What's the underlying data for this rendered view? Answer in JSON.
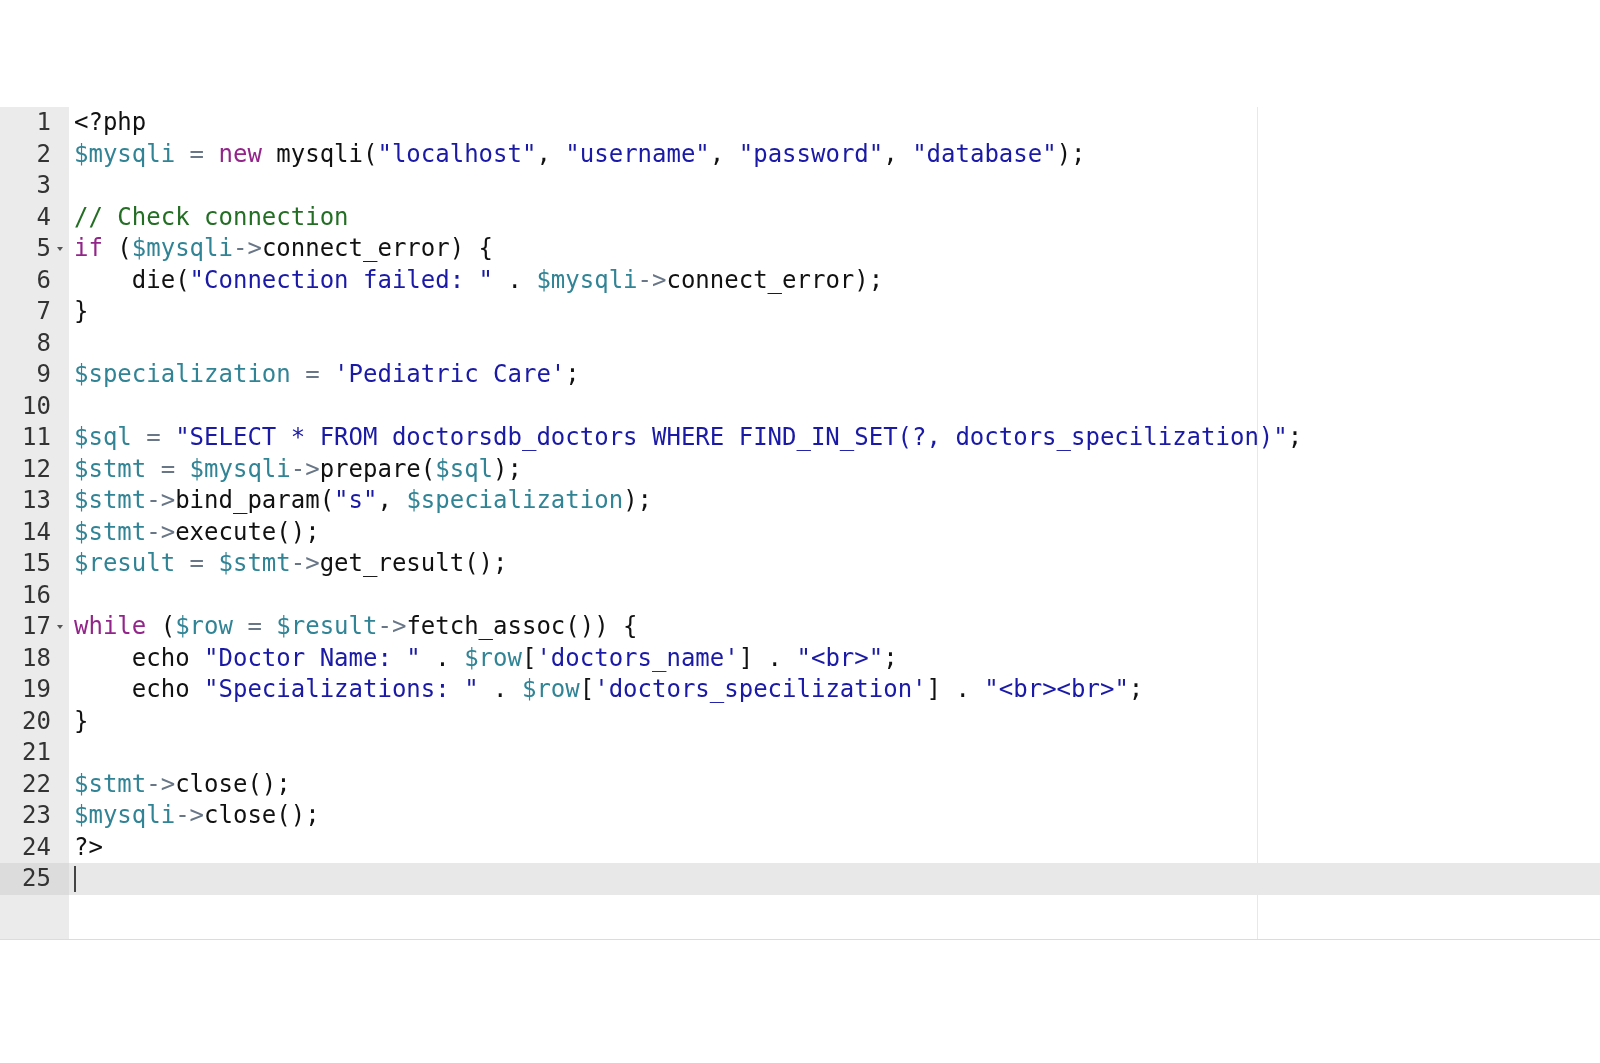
{
  "editor": {
    "lines": [
      {
        "number": "1",
        "foldable": false,
        "active": false,
        "tokens": [
          {
            "kind": "plain",
            "text": "<?php"
          }
        ]
      },
      {
        "number": "2",
        "foldable": false,
        "active": false,
        "tokens": [
          {
            "kind": "variable",
            "text": "$mysqli"
          },
          {
            "kind": "operator",
            "text": " = "
          },
          {
            "kind": "keyword",
            "text": "new"
          },
          {
            "kind": "plain",
            "text": " mysqli("
          },
          {
            "kind": "string",
            "text": "\"localhost\""
          },
          {
            "kind": "plain",
            "text": ", "
          },
          {
            "kind": "string",
            "text": "\"username\""
          },
          {
            "kind": "plain",
            "text": ", "
          },
          {
            "kind": "string",
            "text": "\"password\""
          },
          {
            "kind": "plain",
            "text": ", "
          },
          {
            "kind": "string",
            "text": "\"database\""
          },
          {
            "kind": "plain",
            "text": ");"
          }
        ]
      },
      {
        "number": "3",
        "foldable": false,
        "active": false
      },
      {
        "number": "4",
        "foldable": false,
        "active": false,
        "tokens": [
          {
            "kind": "comment",
            "text": "// Check connection"
          }
        ]
      },
      {
        "number": "5",
        "foldable": true,
        "active": false,
        "tokens": [
          {
            "kind": "keyword",
            "text": "if"
          },
          {
            "kind": "plain",
            "text": " ("
          },
          {
            "kind": "variable",
            "text": "$mysqli"
          },
          {
            "kind": "operator",
            "text": "->"
          },
          {
            "kind": "plain",
            "text": "connect_error) {"
          }
        ]
      },
      {
        "number": "6",
        "foldable": false,
        "active": false,
        "tokens": [
          {
            "kind": "plain",
            "text": "    die("
          },
          {
            "kind": "string",
            "text": "\"Connection failed: \""
          },
          {
            "kind": "plain",
            "text": " . "
          },
          {
            "kind": "variable",
            "text": "$mysqli"
          },
          {
            "kind": "operator",
            "text": "->"
          },
          {
            "kind": "plain",
            "text": "connect_error);"
          }
        ]
      },
      {
        "number": "7",
        "foldable": false,
        "active": false,
        "tokens": [
          {
            "kind": "plain",
            "text": "}"
          }
        ]
      },
      {
        "number": "8",
        "foldable": false,
        "active": false
      },
      {
        "number": "9",
        "foldable": false,
        "active": false,
        "tokens": [
          {
            "kind": "variable",
            "text": "$specialization"
          },
          {
            "kind": "operator",
            "text": " = "
          },
          {
            "kind": "string",
            "text": "'Pediatric Care'"
          },
          {
            "kind": "plain",
            "text": ";"
          }
        ]
      },
      {
        "number": "10",
        "foldable": false,
        "active": false
      },
      {
        "number": "11",
        "foldable": false,
        "active": false,
        "tokens": [
          {
            "kind": "variable",
            "text": "$sql"
          },
          {
            "kind": "operator",
            "text": " = "
          },
          {
            "kind": "string",
            "text": "\"SELECT * FROM doctorsdb_doctors WHERE FIND_IN_SET(?, doctors_specilization)\""
          },
          {
            "kind": "plain",
            "text": ";"
          }
        ]
      },
      {
        "number": "12",
        "foldable": false,
        "active": false,
        "tokens": [
          {
            "kind": "variable",
            "text": "$stmt"
          },
          {
            "kind": "operator",
            "text": " = "
          },
          {
            "kind": "variable",
            "text": "$mysqli"
          },
          {
            "kind": "operator",
            "text": "->"
          },
          {
            "kind": "plain",
            "text": "prepare("
          },
          {
            "kind": "variable",
            "text": "$sql"
          },
          {
            "kind": "plain",
            "text": ");"
          }
        ]
      },
      {
        "number": "13",
        "foldable": false,
        "active": false,
        "tokens": [
          {
            "kind": "variable",
            "text": "$stmt"
          },
          {
            "kind": "operator",
            "text": "->"
          },
          {
            "kind": "plain",
            "text": "bind_param("
          },
          {
            "kind": "string",
            "text": "\"s\""
          },
          {
            "kind": "plain",
            "text": ", "
          },
          {
            "kind": "variable",
            "text": "$specialization"
          },
          {
            "kind": "plain",
            "text": ");"
          }
        ]
      },
      {
        "number": "14",
        "foldable": false,
        "active": false,
        "tokens": [
          {
            "kind": "variable",
            "text": "$stmt"
          },
          {
            "kind": "operator",
            "text": "->"
          },
          {
            "kind": "plain",
            "text": "execute();"
          }
        ]
      },
      {
        "number": "15",
        "foldable": false,
        "active": false,
        "tokens": [
          {
            "kind": "variable",
            "text": "$result"
          },
          {
            "kind": "operator",
            "text": " = "
          },
          {
            "kind": "variable",
            "text": "$stmt"
          },
          {
            "kind": "operator",
            "text": "->"
          },
          {
            "kind": "plain",
            "text": "get_result();"
          }
        ]
      },
      {
        "number": "16",
        "foldable": false,
        "active": false
      },
      {
        "number": "17",
        "foldable": true,
        "active": false,
        "tokens": [
          {
            "kind": "keyword",
            "text": "while"
          },
          {
            "kind": "plain",
            "text": " ("
          },
          {
            "kind": "variable",
            "text": "$row"
          },
          {
            "kind": "operator",
            "text": " = "
          },
          {
            "kind": "variable",
            "text": "$result"
          },
          {
            "kind": "operator",
            "text": "->"
          },
          {
            "kind": "plain",
            "text": "fetch_assoc()) {"
          }
        ]
      },
      {
        "number": "18",
        "foldable": false,
        "active": false,
        "tokens": [
          {
            "kind": "plain",
            "text": "    echo "
          },
          {
            "kind": "string",
            "text": "\"Doctor Name: \""
          },
          {
            "kind": "plain",
            "text": " . "
          },
          {
            "kind": "variable",
            "text": "$row"
          },
          {
            "kind": "plain",
            "text": "["
          },
          {
            "kind": "string",
            "text": "'doctors_name'"
          },
          {
            "kind": "plain",
            "text": "] . "
          },
          {
            "kind": "string",
            "text": "\"<br>\""
          },
          {
            "kind": "plain",
            "text": ";"
          }
        ]
      },
      {
        "number": "19",
        "foldable": false,
        "active": false,
        "tokens": [
          {
            "kind": "plain",
            "text": "    echo "
          },
          {
            "kind": "string",
            "text": "\"Specializations: \""
          },
          {
            "kind": "plain",
            "text": " . "
          },
          {
            "kind": "variable",
            "text": "$row"
          },
          {
            "kind": "plain",
            "text": "["
          },
          {
            "kind": "string",
            "text": "'doctors_specilization'"
          },
          {
            "kind": "plain",
            "text": "] . "
          },
          {
            "kind": "string",
            "text": "\"<br><br>\""
          },
          {
            "kind": "plain",
            "text": ";"
          }
        ]
      },
      {
        "number": "20",
        "foldable": false,
        "active": false,
        "tokens": [
          {
            "kind": "plain",
            "text": "}"
          }
        ]
      },
      {
        "number": "21",
        "foldable": false,
        "active": false
      },
      {
        "number": "22",
        "foldable": false,
        "active": false,
        "tokens": [
          {
            "kind": "variable",
            "text": "$stmt"
          },
          {
            "kind": "operator",
            "text": "->"
          },
          {
            "kind": "plain",
            "text": "close();"
          }
        ]
      },
      {
        "number": "23",
        "foldable": false,
        "active": false,
        "tokens": [
          {
            "kind": "variable",
            "text": "$mysqli"
          },
          {
            "kind": "operator",
            "text": "->"
          },
          {
            "kind": "plain",
            "text": "close();"
          }
        ]
      },
      {
        "number": "24",
        "foldable": false,
        "active": false,
        "tokens": [
          {
            "kind": "plain",
            "text": "?>"
          }
        ]
      },
      {
        "number": "25",
        "foldable": false,
        "active": true
      }
    ]
  }
}
